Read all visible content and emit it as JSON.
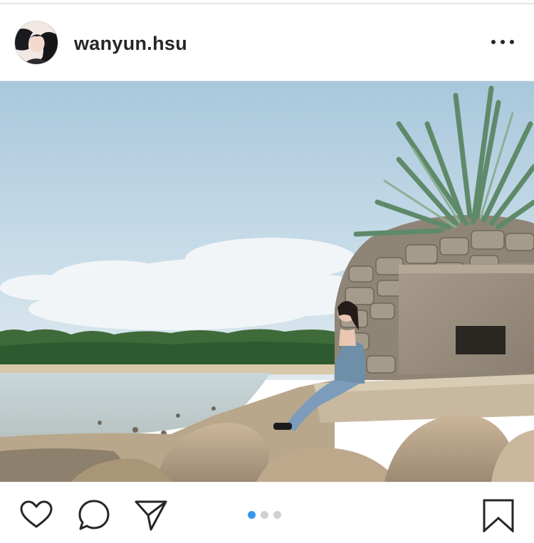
{
  "post": {
    "username": "wanyun.hsu"
  },
  "icons": {
    "avatar": "profile-photo",
    "more": "more-options-icon",
    "like": "heart-icon",
    "comment": "comment-icon",
    "share": "send-icon",
    "save": "bookmark-icon"
  },
  "carousel": {
    "total": 3,
    "active_index": 1
  },
  "colors": {
    "text": "#262626",
    "accent": "#3897f0",
    "dot_inactive": "#d0d0d0"
  }
}
